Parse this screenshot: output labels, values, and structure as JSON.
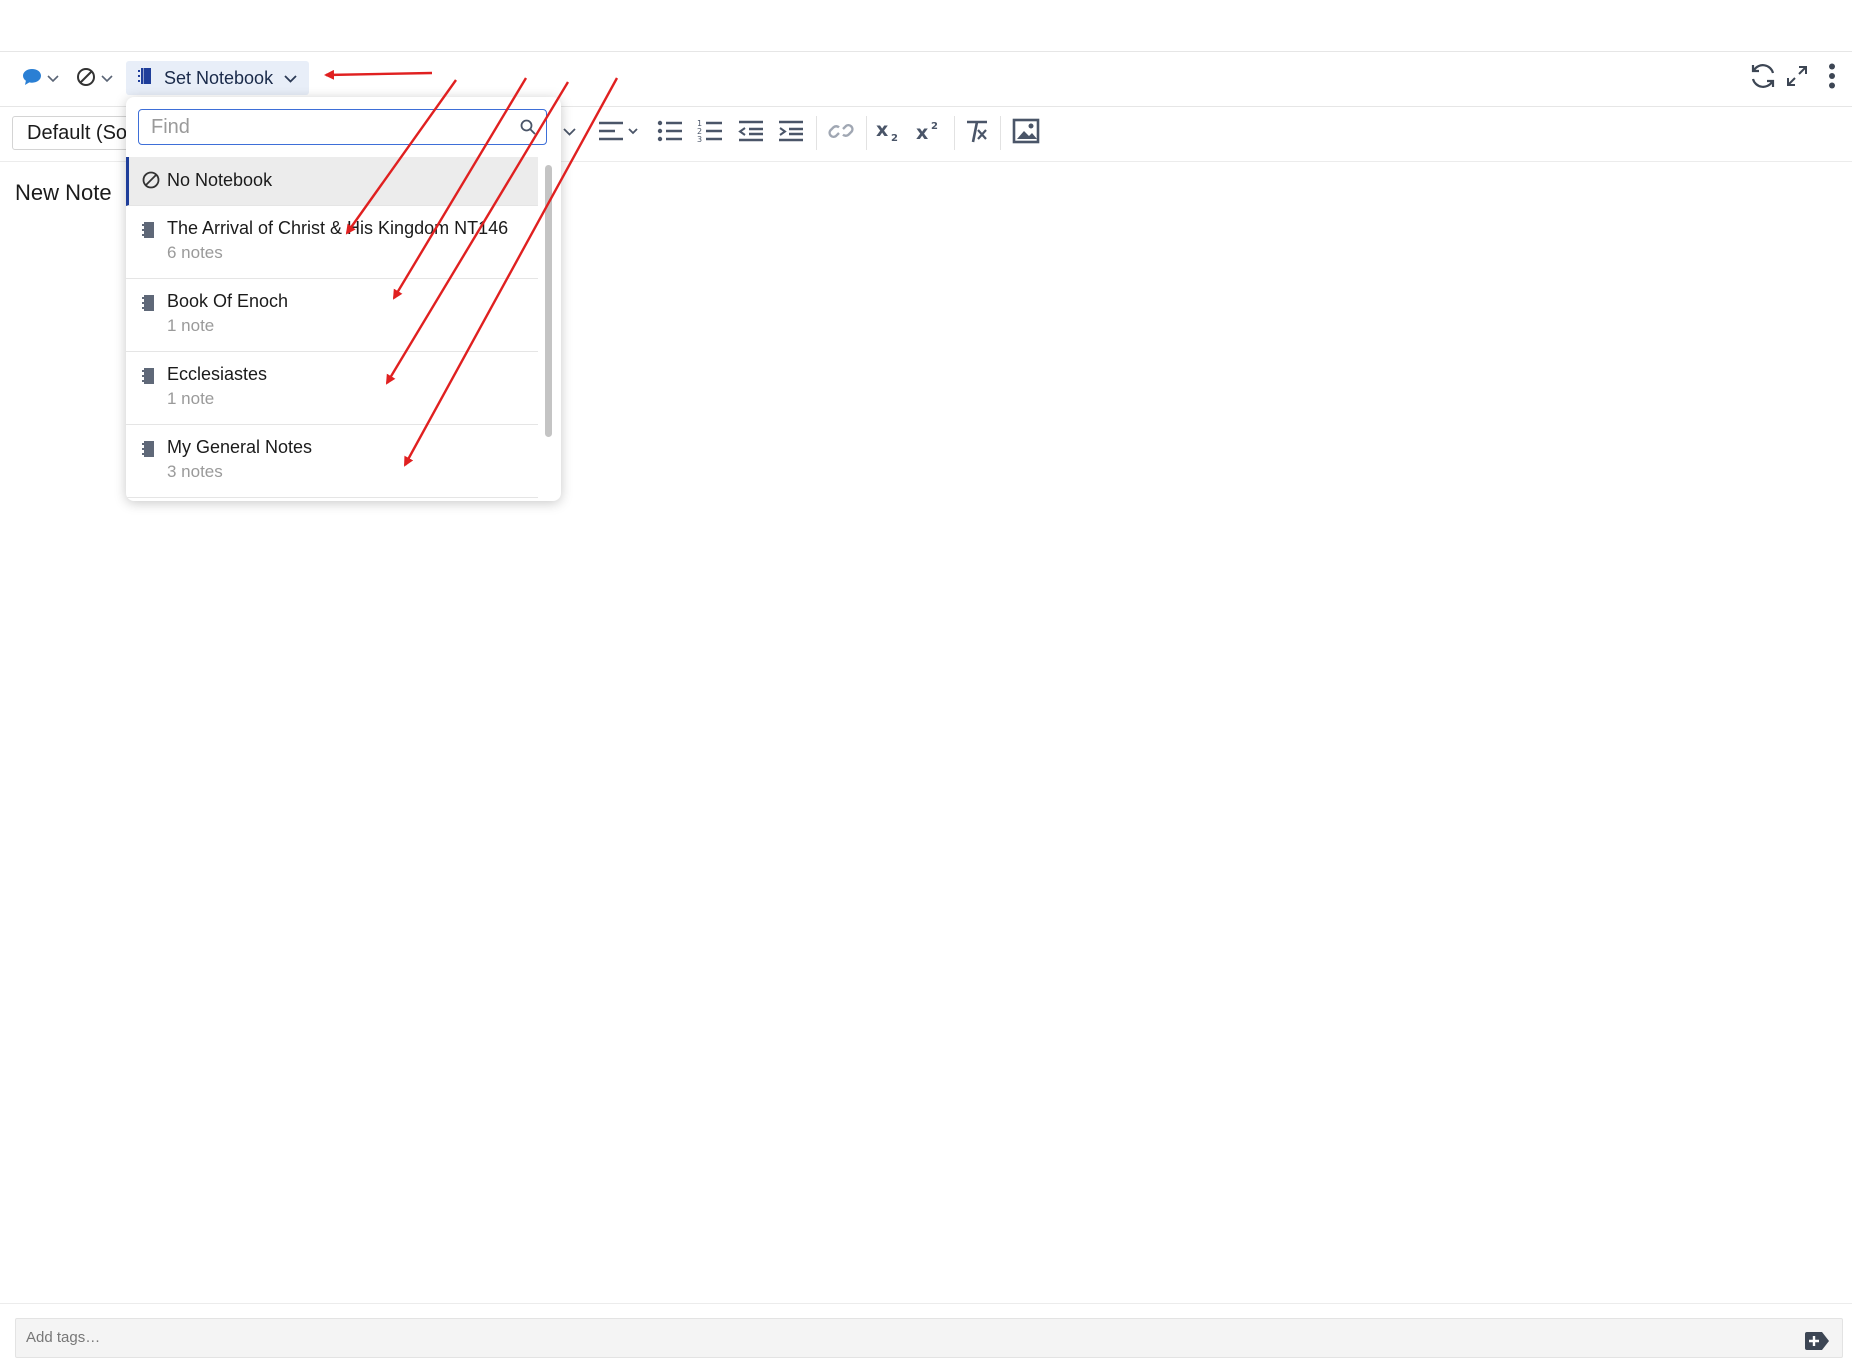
{
  "toolbar": {
    "notebook_button_label": "Set Notebook",
    "style_select_value": "Default (Sou"
  },
  "dropdown": {
    "find_placeholder": "Find",
    "items": [
      {
        "name": "No Notebook",
        "count": ""
      },
      {
        "name": "The Arrival of Christ & His Kingdom NT146",
        "count": "6 notes"
      },
      {
        "name": "Book Of Enoch",
        "count": "1 note"
      },
      {
        "name": "Ecclesiastes",
        "count": "1 note"
      },
      {
        "name": "My General Notes",
        "count": "3 notes"
      }
    ]
  },
  "note": {
    "title": "New Note"
  },
  "tags": {
    "placeholder": "Add tags…"
  },
  "colors": {
    "accent": "#3e6fd8",
    "notebook_icon": "#1f3e9a",
    "annotation_arrow": "#e02020",
    "comment_icon": "#2a7fd4"
  },
  "icons": [
    "comment-icon",
    "no-entry-icon",
    "notebook-icon",
    "chevron-down-icon",
    "search-icon",
    "sync-icon",
    "expand-icon",
    "more-vertical-icon",
    "align-icon",
    "bullet-list-icon",
    "numbered-list-icon",
    "outdent-icon",
    "indent-icon",
    "link-icon",
    "subscript-icon",
    "superscript-icon",
    "clear-format-icon",
    "image-icon",
    "tag-add-icon"
  ]
}
